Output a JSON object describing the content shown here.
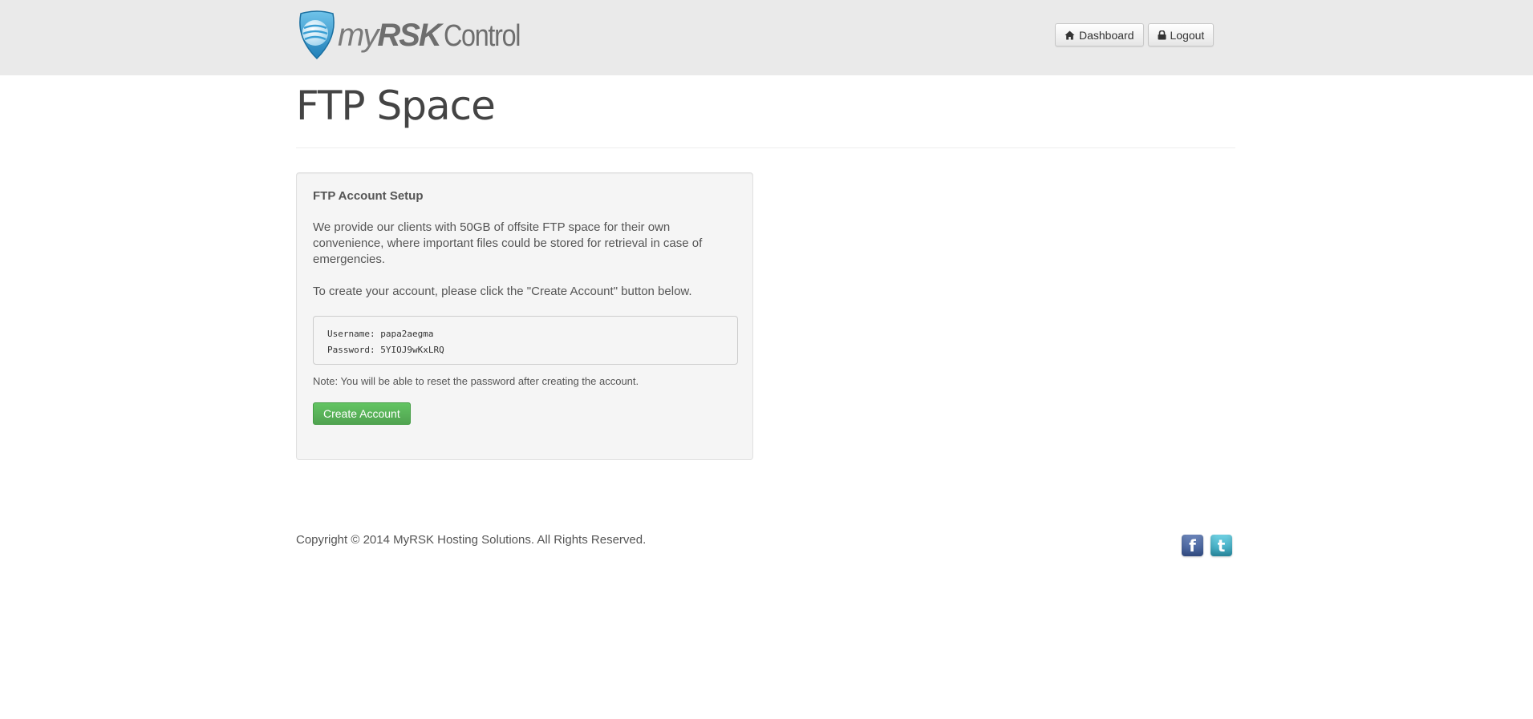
{
  "header": {
    "logo": {
      "part_my": "my",
      "part_rsk": "RSK",
      "part_control": "Control"
    },
    "nav": {
      "dashboard_label": "Dashboard",
      "logout_label": "Logout"
    }
  },
  "page": {
    "title": "FTP Space"
  },
  "setup": {
    "heading": "FTP Account Setup",
    "intro": "We provide our clients with 50GB of offsite FTP space for their own convenience, where important files could be stored for retrieval in case of emergencies.",
    "instruction": "To create your account, please click the \"Create Account\" button below.",
    "credentials": {
      "username_line": "Username: papa2aegma",
      "password_line": "Password: 5YIOJ9wKxLRQ"
    },
    "note": "Note: You will be able to reset the password after creating the account.",
    "create_button_label": "Create Account"
  },
  "footer": {
    "copyright": "Copyright © 2014 MyRSK Hosting Solutions. All Rights Reserved.",
    "social": [
      {
        "icon": "facebook-icon",
        "glyph": "f"
      },
      {
        "icon": "twitter-icon",
        "glyph": "t"
      }
    ]
  },
  "colors": {
    "navbar_bg": "#eaeaea",
    "success_button": "#51a351",
    "well_bg": "#f5f5f5"
  }
}
